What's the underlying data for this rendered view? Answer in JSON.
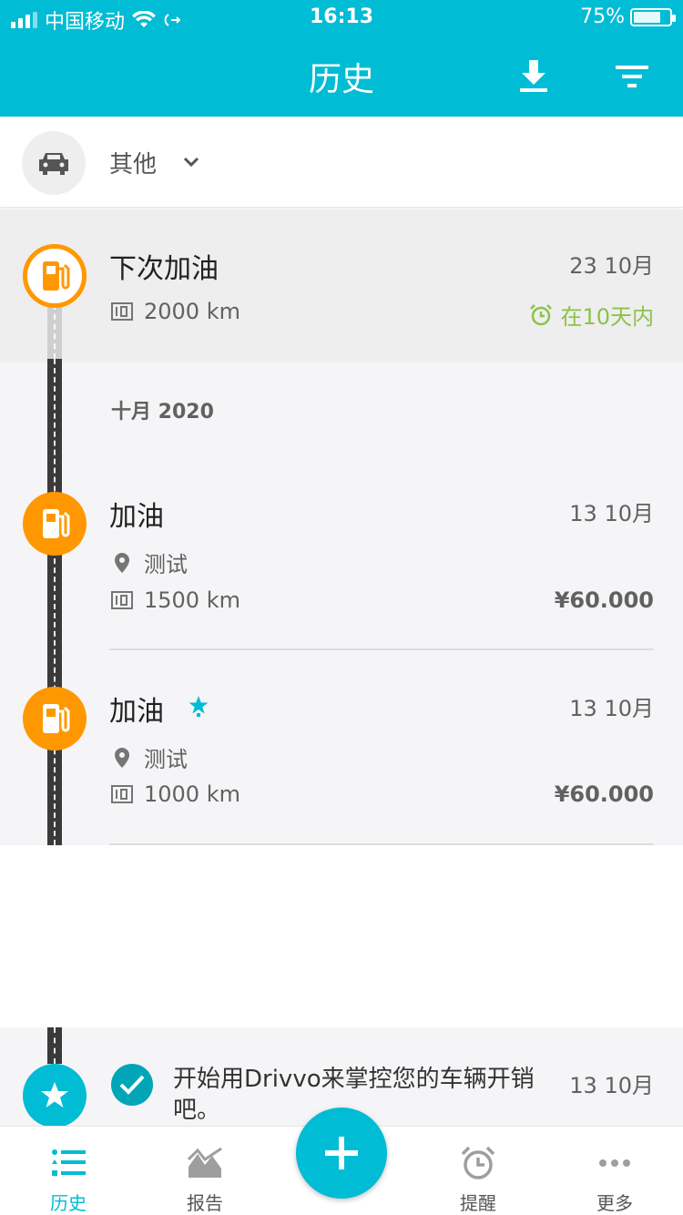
{
  "status_bar": {
    "carrier": "中国移动",
    "time": "16:13",
    "battery": "75%"
  },
  "app_bar": {
    "title": "历史"
  },
  "vehicle": {
    "name": "其他"
  },
  "next_refuel": {
    "title": "下次加油",
    "date": "23 10月",
    "odometer": "2000 km",
    "reminder": "在10天内"
  },
  "month_header": "十月 2020",
  "entries": [
    {
      "title": "加油",
      "date": "13 10月",
      "location": "测试",
      "odometer": "1500 km",
      "price": "¥60.000"
    },
    {
      "title": "加油",
      "date": "13 10月",
      "location": "测试",
      "odometer": "1000 km",
      "price": "¥60.000"
    }
  ],
  "welcome": {
    "text": "开始用Drivvo来掌控您的车辆开销吧。",
    "date": "13 10月"
  },
  "bottom_nav": [
    {
      "label": "历史"
    },
    {
      "label": "报告"
    },
    {
      "label": "提醒"
    },
    {
      "label": "更多"
    }
  ],
  "colors": {
    "primary": "#00bcd4",
    "fuel": "#ff9800",
    "reminder": "#8bc34a"
  }
}
